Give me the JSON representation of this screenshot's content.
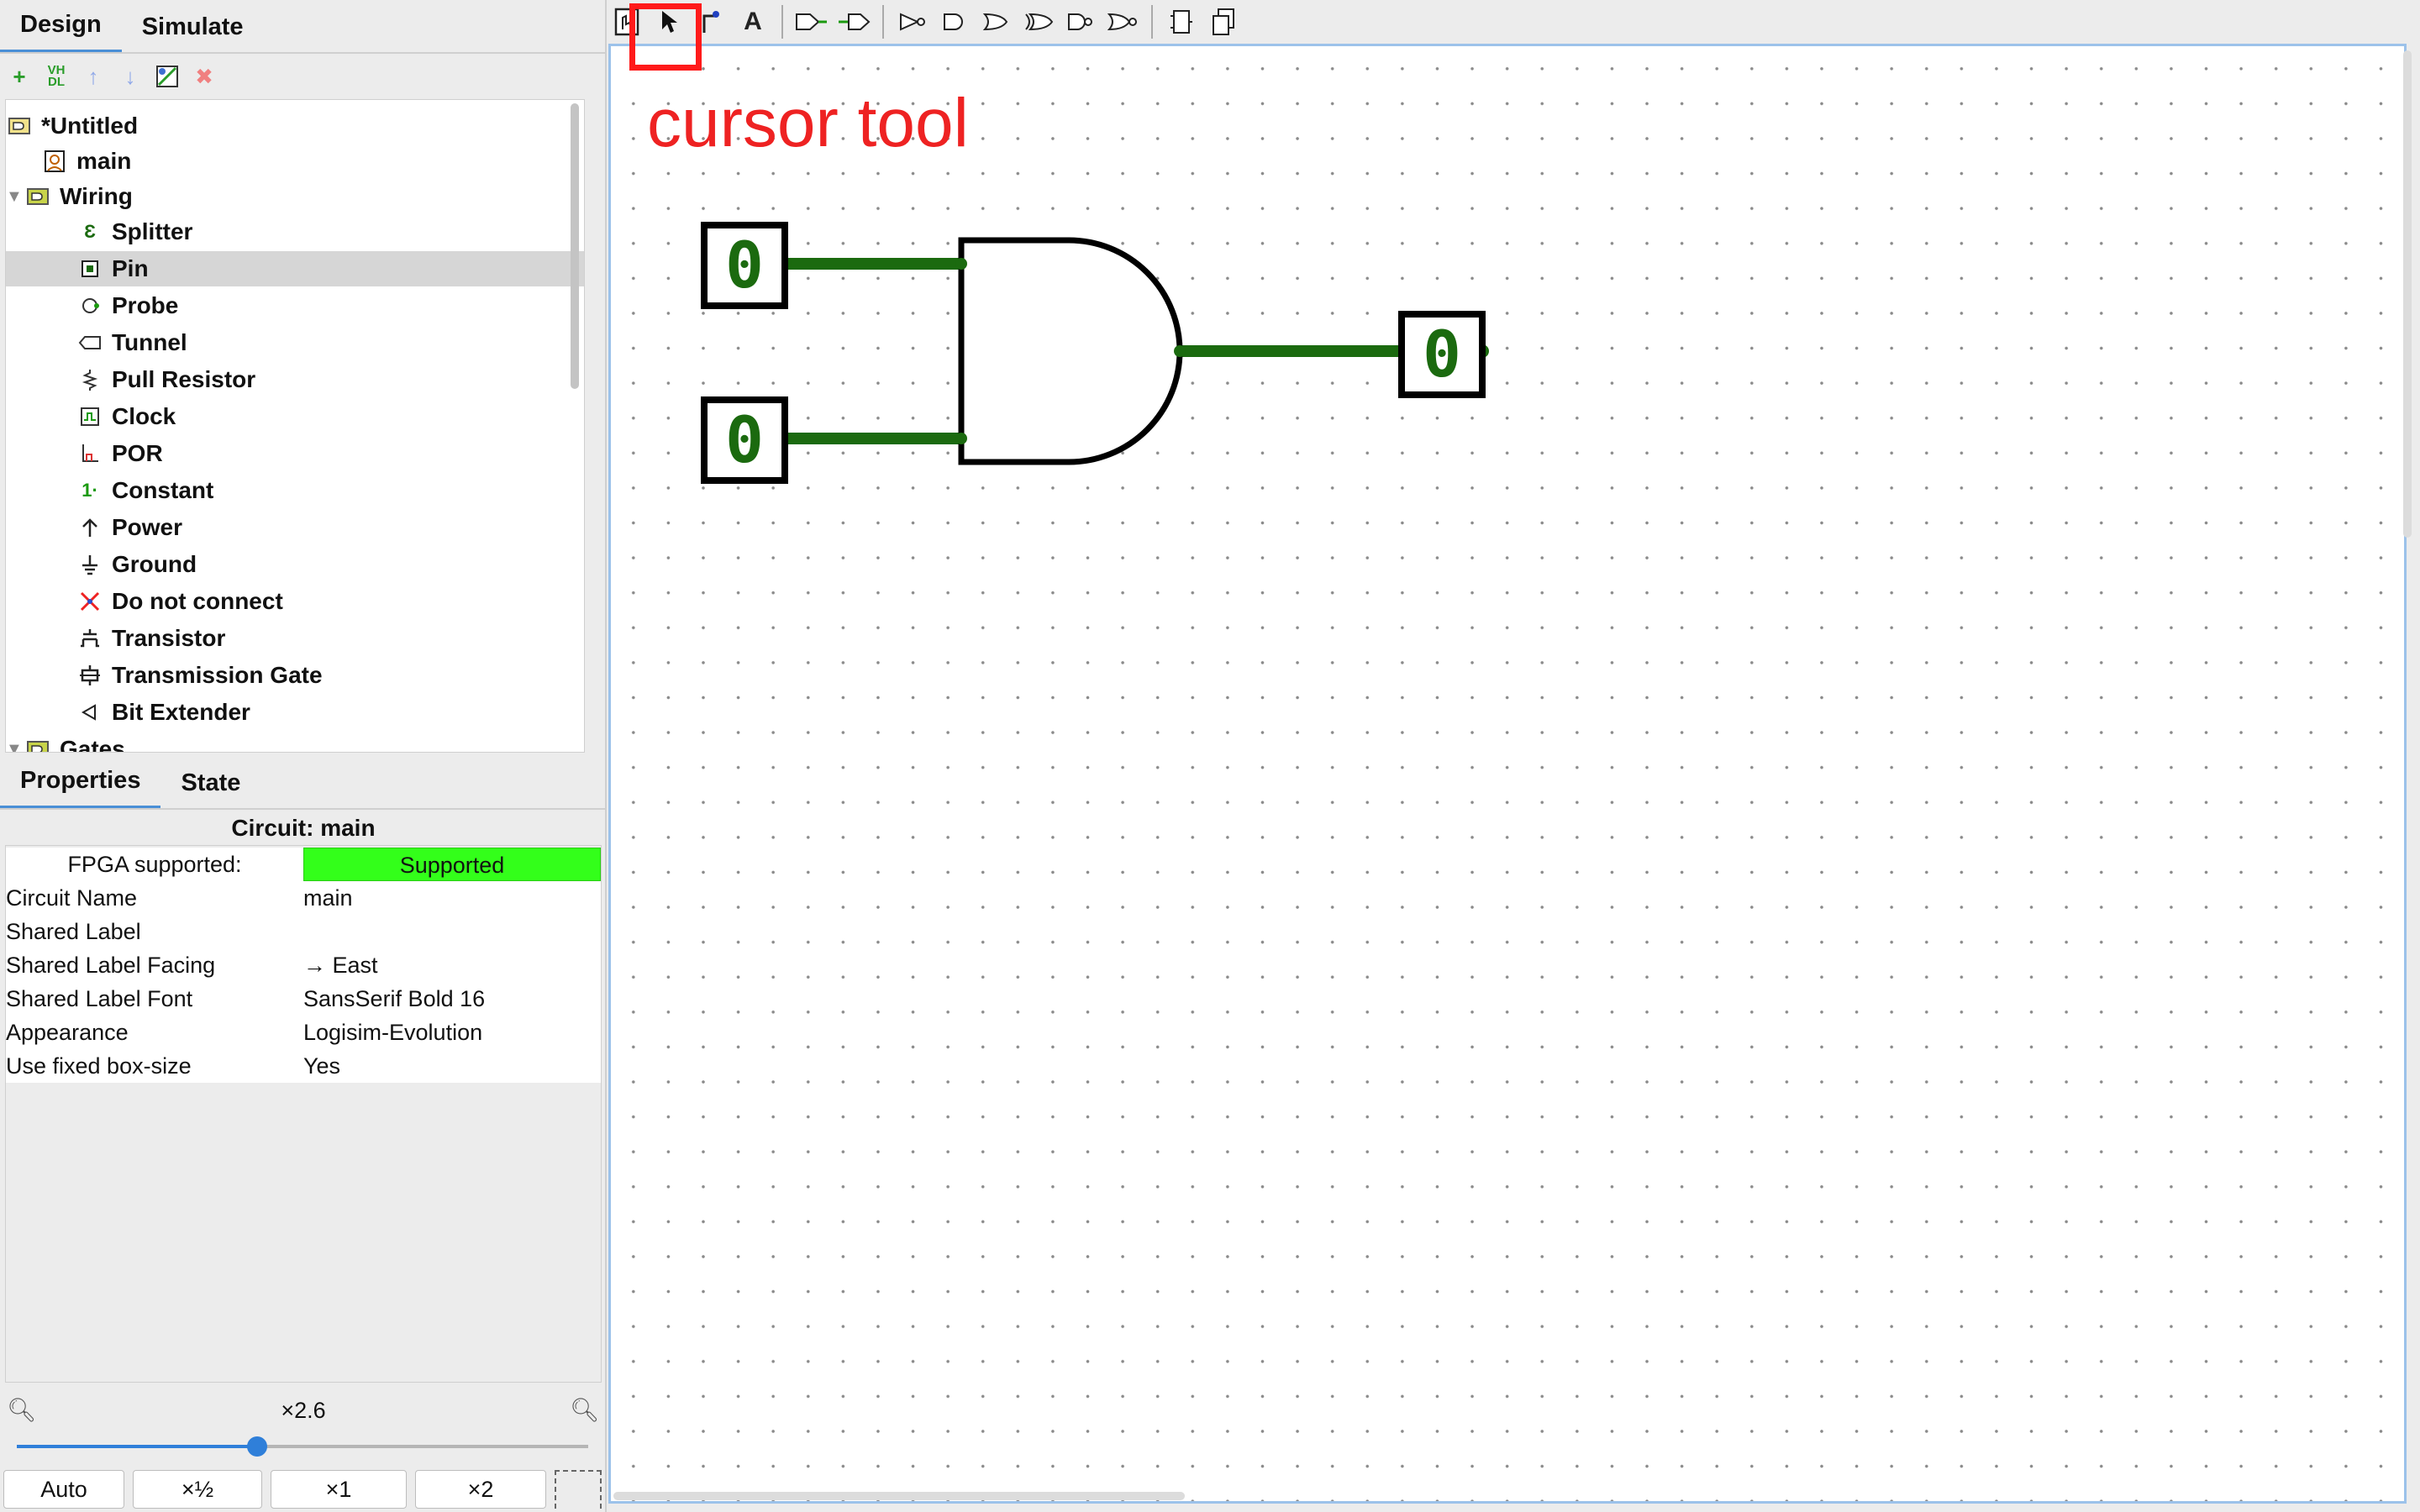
{
  "design_tabs": {
    "design": "Design",
    "simulate": "Simulate"
  },
  "tree": {
    "project": "*Untitled",
    "circuit": "main",
    "wiring_folder": "Wiring",
    "items": [
      {
        "label": "Splitter",
        "icon": "splitter-icon"
      },
      {
        "label": "Pin",
        "icon": "pin-icon"
      },
      {
        "label": "Probe",
        "icon": "probe-icon"
      },
      {
        "label": "Tunnel",
        "icon": "tunnel-icon"
      },
      {
        "label": "Pull Resistor",
        "icon": "pull-resistor-icon"
      },
      {
        "label": "Clock",
        "icon": "clock-icon"
      },
      {
        "label": "POR",
        "icon": "por-icon"
      },
      {
        "label": "Constant",
        "icon": "constant-icon"
      },
      {
        "label": "Power",
        "icon": "power-icon"
      },
      {
        "label": "Ground",
        "icon": "ground-icon"
      },
      {
        "label": "Do not connect",
        "icon": "do-not-connect-icon"
      },
      {
        "label": "Transistor",
        "icon": "transistor-icon"
      },
      {
        "label": "Transmission Gate",
        "icon": "transmission-gate-icon"
      },
      {
        "label": "Bit Extender",
        "icon": "bit-extender-icon"
      }
    ],
    "gates_folder": "Gates",
    "selected": "Pin"
  },
  "props_tabs": {
    "properties": "Properties",
    "state": "State"
  },
  "circuit_title": "Circuit: main",
  "properties": {
    "fpga_key": "FPGA supported:",
    "fpga_value": "Supported",
    "rows": [
      {
        "key": "Circuit Name",
        "value": "main"
      },
      {
        "key": "Shared Label",
        "value": ""
      },
      {
        "key": "Shared Label Facing",
        "value": "→ East"
      },
      {
        "key": "Shared Label Font",
        "value": "SansSerif Bold 16"
      },
      {
        "key": "Appearance",
        "value": "Logisim-Evolution"
      },
      {
        "key": "Use fixed box-size",
        "value": "Yes"
      }
    ]
  },
  "zoom": {
    "label": "×2.6",
    "level": 0.42,
    "buttons": [
      "Auto",
      "×½",
      "×1",
      "×2"
    ]
  },
  "annotation": "cursor tool",
  "circuit": {
    "input_a": "0",
    "input_b": "0",
    "output": "0"
  },
  "colors": {
    "wire_on": "#1b6a0f",
    "fpga_supported": "#33ff1a",
    "annotation": "#ee2222",
    "accent": "#2f7fd9"
  }
}
